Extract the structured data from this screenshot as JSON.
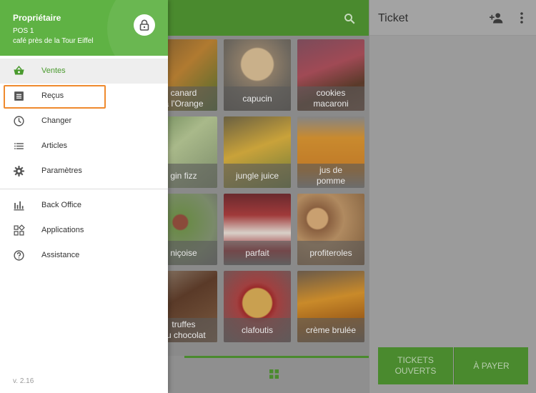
{
  "header": {
    "owner": "Propriétaire",
    "pos": "POS 1",
    "store": "café près de la Tour Eiffel"
  },
  "menu": {
    "items": [
      {
        "label": "Ventes",
        "icon": "basket-icon"
      },
      {
        "label": "Reçus",
        "icon": "receipt-icon"
      },
      {
        "label": "Changer",
        "icon": "clock-icon"
      },
      {
        "label": "Articles",
        "icon": "list-icon"
      },
      {
        "label": "Paramètres",
        "icon": "gear-icon"
      },
      {
        "label": "Back Office",
        "icon": "bar-chart-icon"
      },
      {
        "label": "Applications",
        "icon": "apps-icon"
      },
      {
        "label": "Assistance",
        "icon": "help-icon"
      }
    ]
  },
  "version": "v. 2.16",
  "products": [
    {
      "label": "canard\nà l'Orange"
    },
    {
      "label": "capucin"
    },
    {
      "label": "cookies\nmacaroni"
    },
    {
      "label": "gin fizz"
    },
    {
      "label": "jungle juice"
    },
    {
      "label": "jus de\npomme"
    },
    {
      "label": "niçoise"
    },
    {
      "label": "parfait"
    },
    {
      "label": "profiteroles"
    },
    {
      "label": "truffes\nau chocolat"
    },
    {
      "label": "clafoutis"
    },
    {
      "label": "crème brulée"
    }
  ],
  "ticket": {
    "title": "Ticket",
    "open_tickets": "TICKETS\nOUVERTS",
    "pay": "À PAYER"
  },
  "colors": {
    "brand_green": "#5fb244",
    "highlight": "#ef8a2e"
  }
}
